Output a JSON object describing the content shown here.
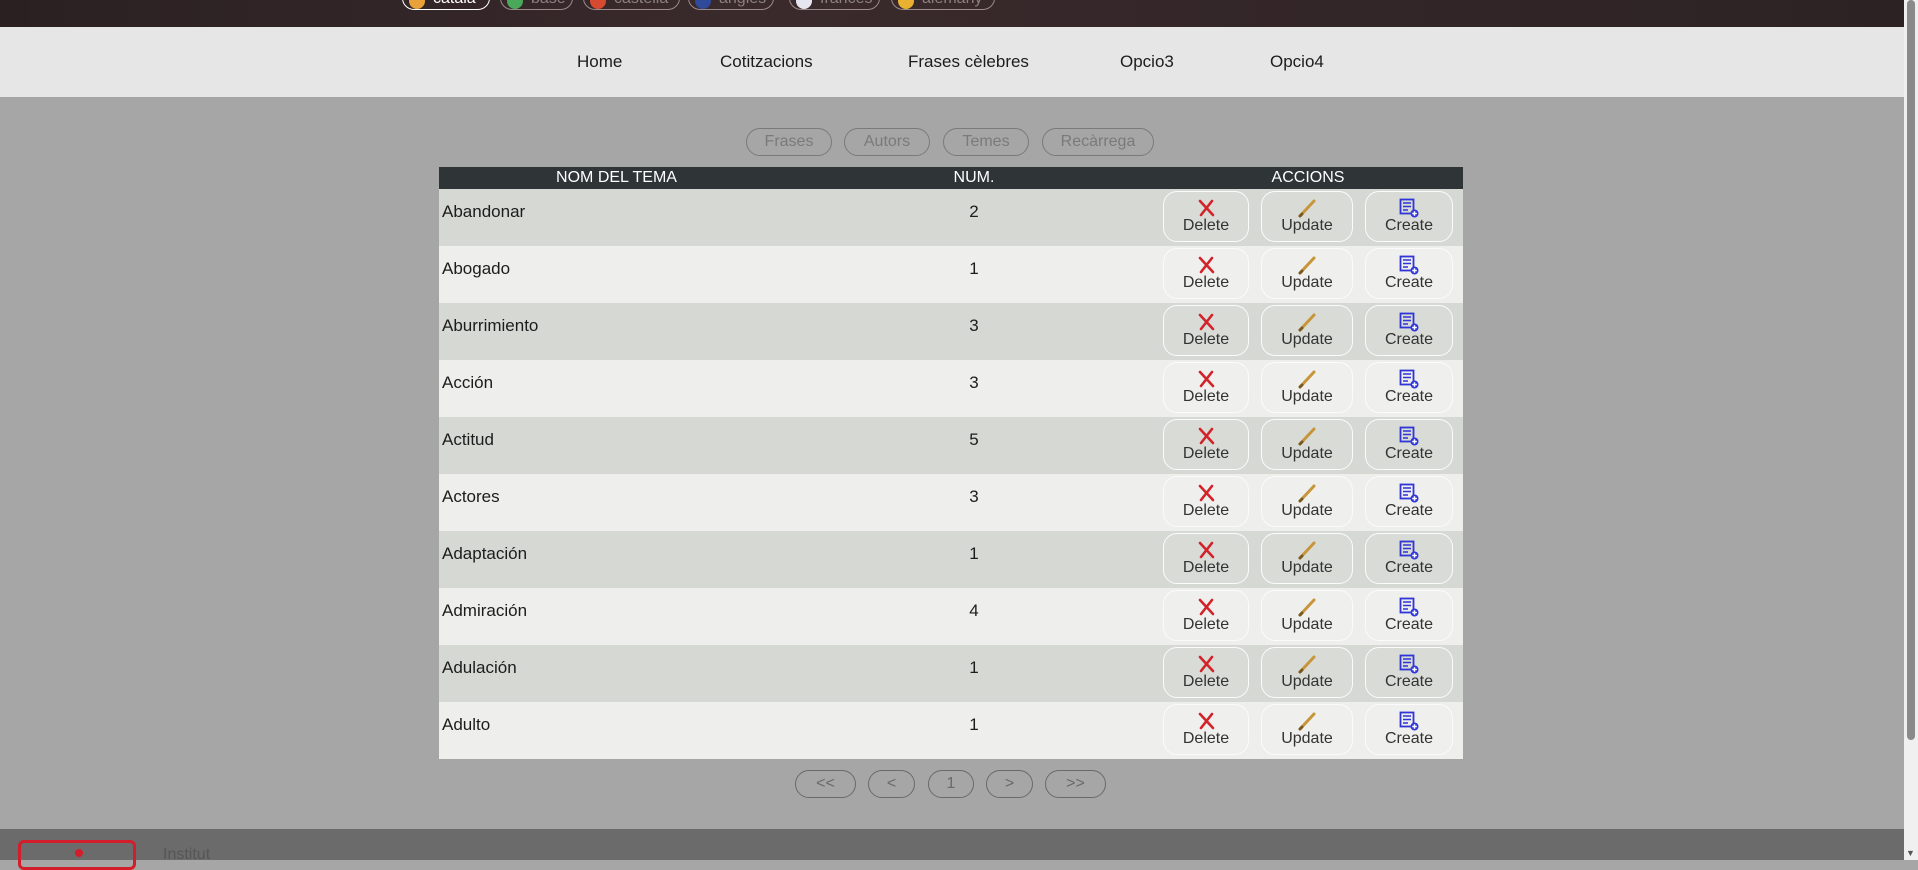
{
  "languages": [
    {
      "label": "català",
      "flag_color": "#e9a23b",
      "active": true
    },
    {
      "label": "base",
      "flag_color": "#4aa85a",
      "active": false
    },
    {
      "label": "castella",
      "flag_color": "#d64a30",
      "active": false
    },
    {
      "label": "anglès",
      "flag_color": "#2f4a9a",
      "active": false
    },
    {
      "label": "francès",
      "flag_color": "#e6e6f0",
      "active": false
    },
    {
      "label": "alemany",
      "flag_color": "#e8b230",
      "active": false
    }
  ],
  "nav": [
    "Home",
    "Cotitzacions",
    "Frases cèlebres",
    "Opcio3",
    "Opcio4"
  ],
  "subnav": [
    "Frases",
    "Autors",
    "Temes",
    "Recàrrega"
  ],
  "table": {
    "headers": {
      "name": "NOM DEL TEMA",
      "num": "NUM.",
      "actions": "ACCIONS"
    },
    "rows": [
      {
        "name": "Abandonar",
        "num": "2"
      },
      {
        "name": "Abogado",
        "num": "1"
      },
      {
        "name": "Aburrimiento",
        "num": "3"
      },
      {
        "name": "Acción",
        "num": "3"
      },
      {
        "name": "Actitud",
        "num": "5"
      },
      {
        "name": "Actores",
        "num": "3"
      },
      {
        "name": "Adaptación",
        "num": "1"
      },
      {
        "name": "Admiración",
        "num": "4"
      },
      {
        "name": "Adulación",
        "num": "1"
      },
      {
        "name": "Adulto",
        "num": "1"
      }
    ],
    "action_labels": {
      "delete": "Delete",
      "update": "Update",
      "create": "Create"
    }
  },
  "pagination": [
    "<<",
    "<",
    "1",
    ">",
    ">>"
  ],
  "footer": {
    "text": "Institut"
  },
  "colors": {
    "delete_icon": "#d2232a",
    "update_icon": "#c8963a",
    "create_icon": "#2f35d8"
  }
}
